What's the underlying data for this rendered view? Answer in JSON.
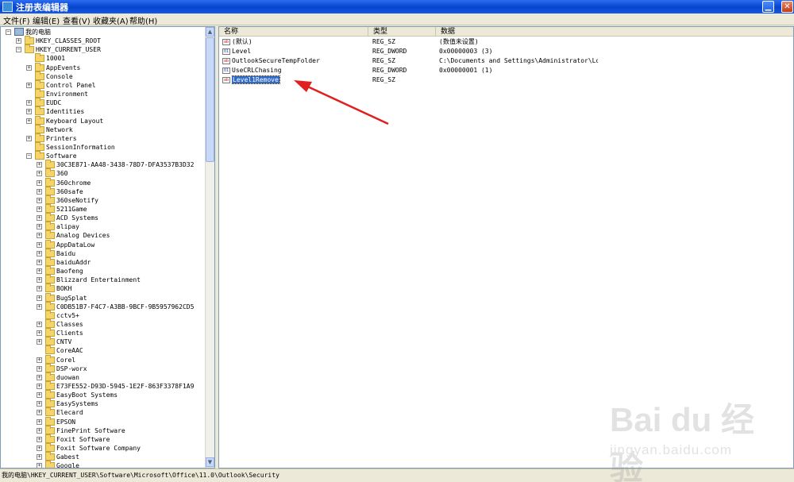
{
  "window": {
    "title": "注册表编辑器"
  },
  "menu": [
    "文件(F)",
    "编辑(E)",
    "查看(V)",
    "收藏夹(A)",
    "帮助(H)"
  ],
  "tree": {
    "root": "我的电脑",
    "hives": [
      {
        "label": "HKEY_CLASSES_ROOT",
        "expanded": false
      },
      {
        "label": "HKEY_CURRENT_USER",
        "expanded": true
      }
    ],
    "hkcu_children": [
      {
        "label": "10001",
        "expander": false
      },
      {
        "label": "AppEvents",
        "expander": true
      },
      {
        "label": "Console",
        "expander": false
      },
      {
        "label": "Control Panel",
        "expander": true
      },
      {
        "label": "Environment",
        "expander": false
      },
      {
        "label": "EUDC",
        "expander": true
      },
      {
        "label": "Identities",
        "expander": true
      },
      {
        "label": "Keyboard Layout",
        "expander": true
      },
      {
        "label": "Network",
        "expander": false
      },
      {
        "label": "Printers",
        "expander": true
      },
      {
        "label": "SessionInformation",
        "expander": false
      },
      {
        "label": "Software",
        "expander": true,
        "expanded": true
      }
    ],
    "software_children": [
      {
        "label": "30C3E871-AA48-3438-78D7-DFA3537B3D32",
        "expander": true
      },
      {
        "label": "360",
        "expander": true
      },
      {
        "label": "360chrome",
        "expander": true
      },
      {
        "label": "360safe",
        "expander": true
      },
      {
        "label": "360seNotify",
        "expander": true
      },
      {
        "label": "5211Game",
        "expander": true
      },
      {
        "label": "ACD Systems",
        "expander": true
      },
      {
        "label": "alipay",
        "expander": true
      },
      {
        "label": "Analog Devices",
        "expander": true
      },
      {
        "label": "AppDataLow",
        "expander": true
      },
      {
        "label": "Baidu",
        "expander": true
      },
      {
        "label": "baiduAddr",
        "expander": true
      },
      {
        "label": "Baofeng",
        "expander": true
      },
      {
        "label": "Blizzard Entertainment",
        "expander": true
      },
      {
        "label": "BOKH",
        "expander": true
      },
      {
        "label": "BugSplat",
        "expander": true
      },
      {
        "label": "C0DB51B7-F4C7-A3BB-9BCF-9B5957962CD5",
        "expander": true
      },
      {
        "label": "cctv5+",
        "expander": false
      },
      {
        "label": "Classes",
        "expander": true
      },
      {
        "label": "Clients",
        "expander": true
      },
      {
        "label": "CNTV",
        "expander": true
      },
      {
        "label": "CoreAAC",
        "expander": false
      },
      {
        "label": "Corel",
        "expander": true
      },
      {
        "label": "DSP-worx",
        "expander": true
      },
      {
        "label": "duowan",
        "expander": true
      },
      {
        "label": "E73FE552-D93D-5945-1E2F-863F3378F1A9",
        "expander": true
      },
      {
        "label": "EasyBoot Systems",
        "expander": true
      },
      {
        "label": "EasySystems",
        "expander": true
      },
      {
        "label": "Elecard",
        "expander": true
      },
      {
        "label": "EPSON",
        "expander": true
      },
      {
        "label": "FinePrint Software",
        "expander": true
      },
      {
        "label": "Foxit Software",
        "expander": true
      },
      {
        "label": "Foxit Software Company",
        "expander": true
      },
      {
        "label": "Gabest",
        "expander": true
      },
      {
        "label": "Google",
        "expander": true
      }
    ]
  },
  "columns": [
    "名称",
    "类型",
    "数据"
  ],
  "values": [
    {
      "name": "(默认)",
      "type": "REG_SZ",
      "data": "(数值未设置)",
      "kind": "sz",
      "selected": false
    },
    {
      "name": "Level",
      "type": "REG_DWORD",
      "data": "0x00000003 (3)",
      "kind": "dw",
      "selected": false
    },
    {
      "name": "OutlookSecureTempFolder",
      "type": "REG_SZ",
      "data": "C:\\Documents and Settings\\Administrator\\Loc...",
      "kind": "sz",
      "selected": false
    },
    {
      "name": "UseCRLChasing",
      "type": "REG_DWORD",
      "data": "0x00000001 (1)",
      "kind": "dw",
      "selected": false
    },
    {
      "name": "Level1Remove",
      "type": "REG_SZ",
      "data": "",
      "kind": "sz",
      "selected": true
    }
  ],
  "status": "我的电脑\\HKEY_CURRENT_USER\\Software\\Microsoft\\Office\\11.0\\Outlook\\Security",
  "watermark": {
    "brand": "Bai du 经验",
    "url": "jingyan.baidu.com"
  },
  "colors": {
    "selection": "#316ac5",
    "arrow": "#e02020"
  }
}
